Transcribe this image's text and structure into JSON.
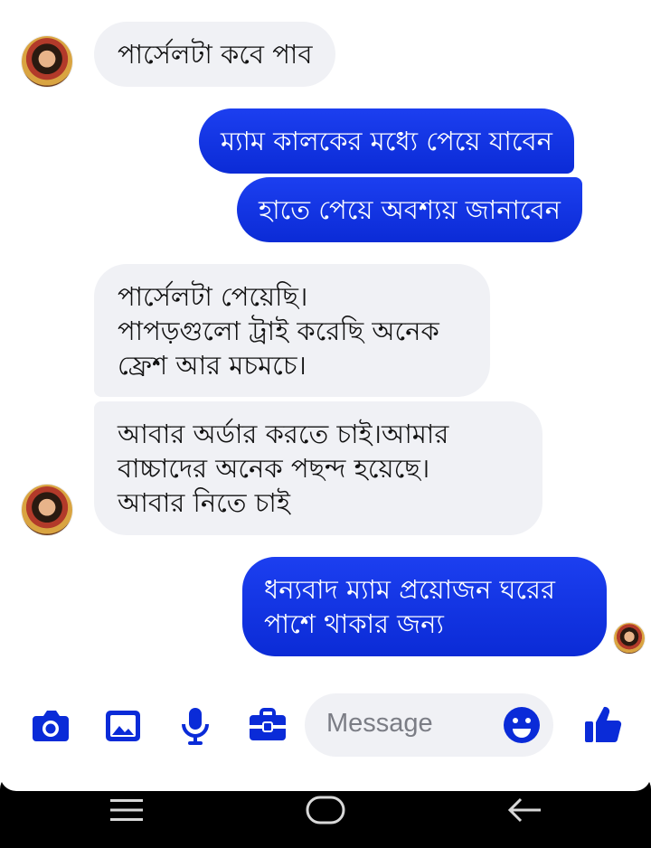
{
  "conversation": {
    "messages": [
      {
        "from": "contact",
        "text": "পার্সেলটা কবে পাব"
      },
      {
        "from": "me",
        "text": "ম্যাম কালকের মধ্যে পেয়ে যাবেন"
      },
      {
        "from": "me",
        "text": "হাতে পেয়ে অবশ্যয় জানাবেন"
      },
      {
        "from": "contact",
        "text": "পার্সেলটা পেয়েছি।\nপাপড়গুলো ট্রাই করেছি অনেক\nফ্রেশ আর মচমচে।"
      },
      {
        "from": "contact",
        "text": "আবার অর্ডার করতে চাই।আমার\nবাচ্চাদের অনেক পছন্দ হয়েছে।\nআবার নিতে চাই"
      },
      {
        "from": "me",
        "text": "ধন্যবাদ ম্যাম প্রয়োজন ঘরের\nপাশে থাকার জন্য"
      }
    ]
  },
  "composer": {
    "placeholder": "Message",
    "icons": [
      "camera-icon",
      "image-icon",
      "microphone-icon",
      "briefcase-icon",
      "emoji-icon",
      "thumbs-up-icon"
    ],
    "accent_color": "#0a2bd8"
  },
  "system_nav": {
    "icons": [
      "menu-icon",
      "home-icon",
      "back-icon"
    ]
  }
}
